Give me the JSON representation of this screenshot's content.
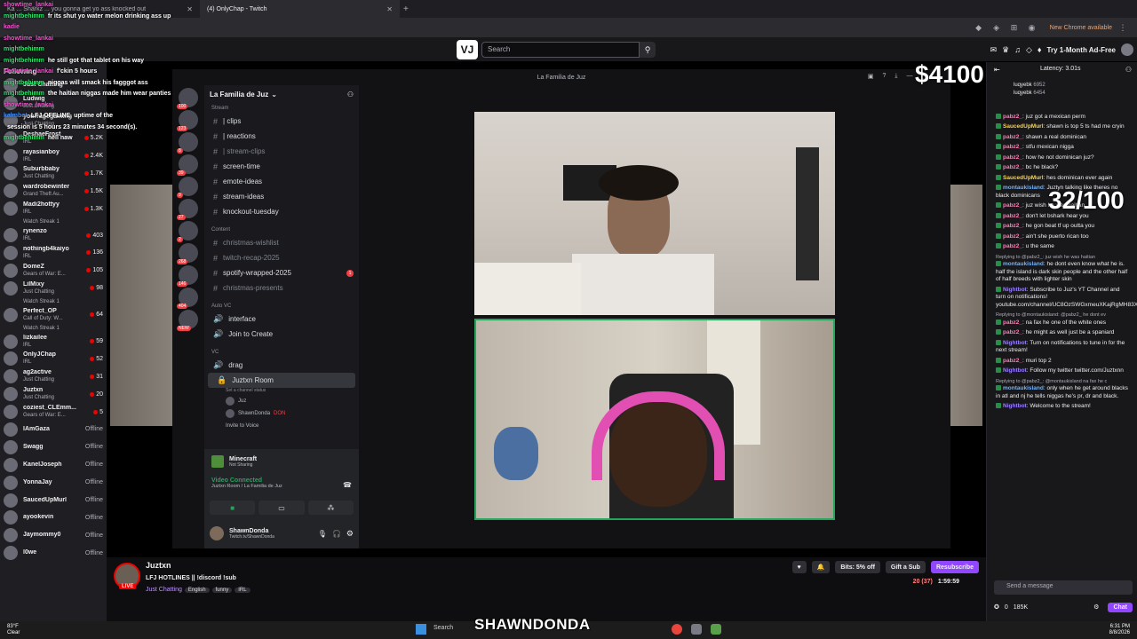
{
  "browser": {
    "tabs": [
      {
        "label": "Ka ... Sharkz ... you gonna get yo ass knocked out"
      },
      {
        "label": "(4) OnlyChap - Twitch"
      }
    ],
    "new_chrome": "New Chrome available"
  },
  "twitch_nav": {
    "logo": "VJ",
    "search_placeholder": "Search",
    "ad_free": "Try 1-Month Ad-Free"
  },
  "left_nav": {
    "header": "Following",
    "channels": [
      {
        "name": "Just Chatting",
        "game": "",
        "viewers": "",
        "status": "live"
      },
      {
        "name": "Ludwig",
        "game": "Just Chatting",
        "viewers": "",
        "status": "live"
      },
      {
        "name": "yourragegaming",
        "game": "Just Chatting",
        "viewers": "",
        "status": "live"
      },
      {
        "name": "DeshaeFrost",
        "game": "IRL",
        "viewers": "5.2K",
        "status": "live"
      },
      {
        "name": "rayasianboy",
        "game": "IRL",
        "viewers": "2.4K",
        "status": "live"
      },
      {
        "name": "Suburbbaby",
        "game": "Just Chatting",
        "viewers": "1.7K",
        "status": "live"
      },
      {
        "name": "wardrobewinter",
        "game": "Grand Theft Au...",
        "viewers": "1.5K",
        "status": "live"
      },
      {
        "name": "Madi2hottyy",
        "game": "IRL",
        "viewers": "1.3K",
        "status": "live",
        "streak": "Watch Streak 1"
      },
      {
        "name": "rynenzo",
        "game": "IRL",
        "viewers": "403",
        "status": "live"
      },
      {
        "name": "nothingb4kaiyo",
        "game": "IRL",
        "viewers": "136",
        "status": "live"
      },
      {
        "name": "DomeZ",
        "game": "Gears of War: E...",
        "viewers": "105",
        "status": "live"
      },
      {
        "name": "LilMixy",
        "game": "Just Chatting",
        "viewers": "98",
        "status": "live",
        "streak": "Watch Streak 1"
      },
      {
        "name": "Perfect_OP",
        "game": "Call of Duty: W...",
        "viewers": "64",
        "status": "live",
        "streak": "Watch Streak 1"
      },
      {
        "name": "lizkailee",
        "game": "IRL",
        "viewers": "59",
        "status": "live"
      },
      {
        "name": "OnlyJChap",
        "game": "IRL",
        "viewers": "52",
        "status": "live"
      },
      {
        "name": "ag2active",
        "game": "Just Chatting",
        "viewers": "31",
        "status": "live"
      },
      {
        "name": "Juztxn",
        "game": "Just Chatting",
        "viewers": "20",
        "status": "live"
      },
      {
        "name": "coziest_CLEmm...",
        "game": "Gears of War: E...",
        "viewers": "5",
        "status": "live"
      },
      {
        "name": "IAmGaza",
        "game": "",
        "viewers": "Offline",
        "status": "offline"
      },
      {
        "name": "Swagg",
        "game": "",
        "viewers": "Offline",
        "status": "offline"
      },
      {
        "name": "KanelJoseph",
        "game": "",
        "viewers": "Offline",
        "status": "offline"
      },
      {
        "name": "YonnaJay",
        "game": "",
        "viewers": "Offline",
        "status": "offline"
      },
      {
        "name": "SaucedUpMurl",
        "game": "",
        "viewers": "Offline",
        "status": "offline"
      },
      {
        "name": "ayookevin",
        "game": "",
        "viewers": "Offline",
        "status": "offline"
      },
      {
        "name": "Jaymommy0",
        "game": "",
        "viewers": "Offline",
        "status": "offline"
      },
      {
        "name": "l0we",
        "game": "",
        "viewers": "Offline",
        "status": "offline"
      }
    ]
  },
  "overlay_chat": [
    {
      "u": "showtime_lankai",
      "t": "",
      "c": "#ff4bd8"
    },
    {
      "u": "mightbehimm",
      "t": "fr its shut yo water melon drinking ass up",
      "c": "#2fe36d"
    },
    {
      "u": "kadie",
      "t": "",
      "c": "#ff4bd8"
    },
    {
      "u": "showtime_lankai",
      "t": "",
      "c": "#ff4bd8"
    },
    {
      "u": "mightbehimm",
      "t": "",
      "c": "#2fe36d"
    },
    {
      "u": "mightbehimm",
      "t": "he still got that tablet on his way",
      "c": "#2fe36d"
    },
    {
      "u": "showtime_lankai",
      "t": "f'ckin 5 hours",
      "c": "#ff4bd8"
    },
    {
      "u": "mightbehimm",
      "t": "niggas will smack his fagggot ass",
      "c": "#2fe36d"
    },
    {
      "u": "mightbehimm",
      "t": "the haitian niggas made him wear panties",
      "c": "#2fe36d"
    },
    {
      "u": "showtime_lankai",
      "t": "",
      "c": "#ff4bd8"
    },
    {
      "u": "kalmbot",
      "t": "LFJ OFFLINE, uptime of the",
      "c": "#3e8bff"
    },
    {
      "u": "",
      "t": "session is 5 hours 23 minutes 34 second(s).",
      "c": "#3e8bff"
    },
    {
      "u": "mightbehimm",
      "t": "hell naw",
      "c": "#2fe36d"
    }
  ],
  "discord": {
    "window_title": "La Familia de Juz",
    "server_name": "La Familia de Juz",
    "categories": {
      "stream": "Stream",
      "content": "Content",
      "auto_vc": "Auto VC",
      "vc": "VC"
    },
    "stream_channels": [
      {
        "name": "| clips",
        "muted": false
      },
      {
        "name": "| reactions",
        "muted": false
      },
      {
        "name": "| stream-clips",
        "muted": true
      },
      {
        "name": "screen-time",
        "muted": false
      },
      {
        "name": "emote-ideas",
        "muted": false
      },
      {
        "name": "stream-ideas",
        "muted": false
      },
      {
        "name": "knockout-tuesday",
        "muted": false
      }
    ],
    "content_channels": [
      {
        "name": "christmas-wishlist",
        "muted": true,
        "badge": ""
      },
      {
        "name": "twitch-recap-2025",
        "muted": true,
        "badge": ""
      },
      {
        "name": "spotify-wrapped-2025",
        "muted": false,
        "badge": "1"
      },
      {
        "name": "christmas-presents",
        "muted": true,
        "badge": ""
      }
    ],
    "auto_vc_channels": [
      {
        "name": "interface"
      },
      {
        "name": "Join to Create"
      }
    ],
    "vc_channels": [
      {
        "name": "drag"
      }
    ],
    "voice_room": {
      "name": "Juztxn Room",
      "status": "Set a channel status",
      "users": [
        {
          "name": "Juz"
        },
        {
          "name": "ShawnDonda",
          "tag": "DON"
        }
      ],
      "invite": "Invite to Voice"
    },
    "server_badges": [
      "100",
      "123",
      "8",
      "39",
      "9",
      "27",
      "2",
      "268",
      "146",
      "404",
      "NEW"
    ],
    "activity": {
      "title": "Minecraft",
      "subtitle": "Not Sharing"
    },
    "voice": {
      "status": "Video Connected",
      "location": "Juztxn Room / La Familia de Juz"
    },
    "user": {
      "name": "ShawnDonda",
      "sub": "Twitch.tv/ShawnDonda"
    }
  },
  "stream": {
    "streamer": "Juztxn",
    "live_label": "LIVE",
    "title": "LFJ HOTLINES || !discord !sub",
    "category": "Just Chatting",
    "tags": [
      "English",
      "funny",
      "IRL"
    ],
    "bits": "Bits: 5% off",
    "gift": "Gift a Sub",
    "subscribe": "Resubscribe",
    "viewers": "20 (37)",
    "uptime": "1:59:59"
  },
  "chat": {
    "latency": "Latency: 3.01s",
    "pinned": [
      {
        "name": "luqyebk",
        "count": "6952"
      },
      {
        "name": "luqyebk",
        "count": "6454"
      }
    ],
    "messages": [
      {
        "u": "pabz2_",
        "t": "juz got a mexican perm",
        "c": "#ff7eb6"
      },
      {
        "u": "SaucedUpMurl",
        "t": "shawn is top 5 ts had me cryin",
        "c": "#ffd33f"
      },
      {
        "u": "pabz2_",
        "t": "shawn a real dominican",
        "c": "#ff7eb6"
      },
      {
        "u": "pabz2_",
        "t": "stfu mexican nigga",
        "c": "#ff7eb6"
      },
      {
        "u": "pabz2_",
        "t": "how he not dominican juz?",
        "c": "#ff7eb6"
      },
      {
        "u": "pabz2_",
        "t": "bc he black?",
        "c": "#ff7eb6"
      },
      {
        "u": "SaucedUpMurl",
        "t": "hes dominican ever again",
        "c": "#ffd33f"
      },
      {
        "u": "montaukisland",
        "t": "Juztyn talking like theres no black dominicans",
        "c": "#6fb3ff"
      },
      {
        "u": "pabz2_",
        "t": "juz wish he was haitian",
        "c": "#ff7eb6"
      },
      {
        "u": "pabz2_",
        "t": "don't let bshark hear you",
        "c": "#ff7eb6"
      },
      {
        "u": "pabz2_",
        "t": "he gon beat tf up outta you",
        "c": "#ff7eb6"
      },
      {
        "u": "pabz2_",
        "t": "ain't she puerto rican too",
        "c": "#ff7eb6"
      },
      {
        "u": "pabz2_",
        "t": "u the same",
        "c": "#ff7eb6"
      },
      {
        "u": "montaukisland",
        "t": "he dont even know what he is. half the island is dark skin people and the other half of half breeds with lighter skin",
        "c": "#6fb3ff",
        "reply": "Replying to @pabz2_: juz wish he was haitian"
      },
      {
        "u": "Nightbot",
        "t": "Subscribe to Juz's YT Channel and turn on notifications! youtube.com/channel/UC8OzSWGxmeuXKajRgMH83XA",
        "c": "#9a7fff"
      },
      {
        "u": "pabz2_",
        "t": "na fax he one of the white ones",
        "c": "#ff7eb6",
        "reply": "Replying to @montaukisland: @pabz2_ he dont ev"
      },
      {
        "u": "pabz2_",
        "t": "he might as well just be a spaniard",
        "c": "#ff7eb6"
      },
      {
        "u": "Nightbot",
        "t": "Turn on notifications to tune in for the next stream!",
        "c": "#9a7fff"
      },
      {
        "u": "pabz2_",
        "t": "muri top 2",
        "c": "#ff7eb6"
      },
      {
        "u": "Nightbot",
        "t": "Follow my twitter twitter.com/Juztxnn",
        "c": "#9a7fff"
      },
      {
        "u": "montaukisland",
        "t": "only when he get around blacks in atl and nj he tells niggas he's pr, dr and black.",
        "c": "#6fb3ff",
        "reply": "Replying to @pabz2_: @montaukisland na fax he c"
      },
      {
        "u": "Nightbot",
        "t": "Welcome to the stream!",
        "c": "#9a7fff"
      }
    ],
    "input_placeholder": "Send a message",
    "points": "0",
    "points_total": "185K",
    "chat_button": "Chat"
  },
  "overlays": {
    "counter": "32/100",
    "counter_top": "$4100",
    "streamer_name": "SHAWNDONDA"
  },
  "taskbar": {
    "weather_temp": "83°F",
    "weather_desc": "Clear",
    "search": "Search",
    "time": "6:31 PM",
    "date": "8/8/2026"
  }
}
